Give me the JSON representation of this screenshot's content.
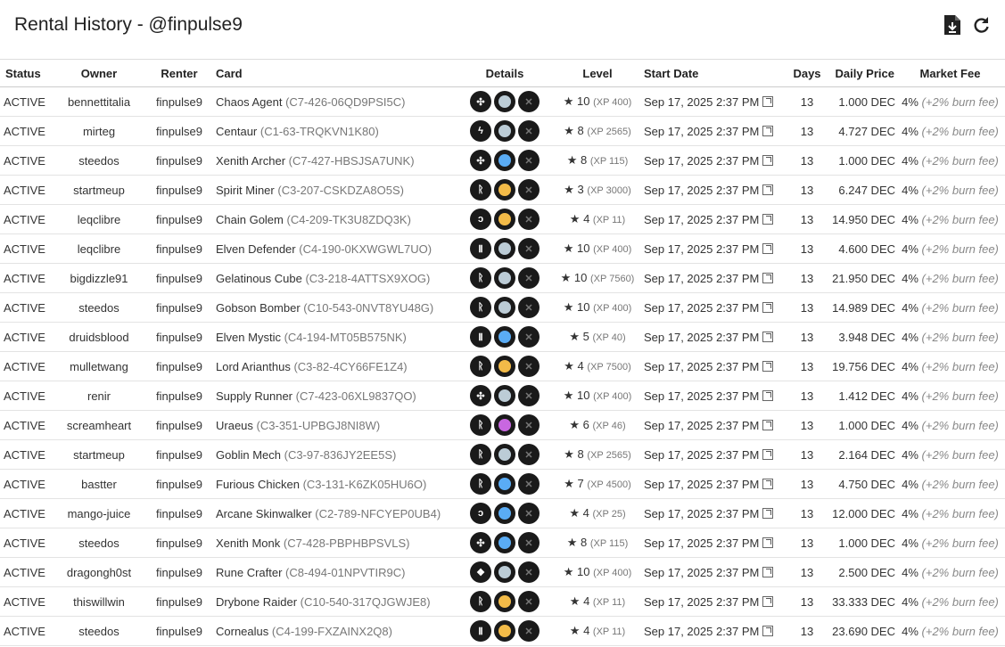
{
  "header": {
    "title": "Rental History - @finpulse9"
  },
  "columns": [
    "Status",
    "Owner",
    "Renter",
    "Card",
    "Details",
    "Level",
    "Start Date",
    "Days",
    "Daily Price",
    "Market Fee"
  ],
  "colors": {
    "grey": "#bcccd6",
    "blue": "#5aacf5",
    "gold": "#f3bb48",
    "purple": "#c867e0"
  },
  "rows": [
    [
      "ACTIVE",
      "bennettitalia",
      "finpulse9",
      "Chaos Agent",
      "(C7-426-06QD9PSI5C)",
      "chaos",
      "grey",
      "10",
      "(XP 400)",
      "Sep 17, 2025 2:37 PM",
      "13",
      "1.000 DEC",
      "4%",
      "(+2% burn fee)"
    ],
    [
      "ACTIVE",
      "mirteg",
      "finpulse9",
      "Centaur",
      "(C1-63-TRQKVN1K80)",
      "alpha",
      "grey",
      "8",
      "(XP 2565)",
      "Sep 17, 2025 2:37 PM",
      "13",
      "4.727 DEC",
      "4%",
      "(+2% burn fee)"
    ],
    [
      "ACTIVE",
      "steedos",
      "finpulse9",
      "Xenith Archer",
      "(C7-427-HBSJSA7UNK)",
      "chaos",
      "blue",
      "8",
      "(XP 115)",
      "Sep 17, 2025 2:37 PM",
      "13",
      "1.000 DEC",
      "4%",
      "(+2% burn fee)"
    ],
    [
      "ACTIVE",
      "startmeup",
      "finpulse9",
      "Spirit Miner",
      "(C3-207-CSKDZA8O5S)",
      "reward",
      "gold",
      "3",
      "(XP 3000)",
      "Sep 17, 2025 2:37 PM",
      "13",
      "6.247 DEC",
      "4%",
      "(+2% burn fee)"
    ],
    [
      "ACTIVE",
      "leqclibre",
      "finpulse9",
      "Chain Golem",
      "(C4-209-TK3U8ZDQ3K)",
      "promo",
      "gold",
      "4",
      "(XP 11)",
      "Sep 17, 2025 2:37 PM",
      "13",
      "14.950 DEC",
      "4%",
      "(+2% burn fee)"
    ],
    [
      "ACTIVE",
      "leqclibre",
      "finpulse9",
      "Elven Defender",
      "(C4-190-0KXWGWL7UO)",
      "untamed",
      "grey",
      "10",
      "(XP 400)",
      "Sep 17, 2025 2:37 PM",
      "13",
      "4.600 DEC",
      "4%",
      "(+2% burn fee)"
    ],
    [
      "ACTIVE",
      "bigdizzle91",
      "finpulse9",
      "Gelatinous Cube",
      "(C3-218-4ATTSX9XOG)",
      "reward",
      "grey",
      "10",
      "(XP 7560)",
      "Sep 17, 2025 2:37 PM",
      "13",
      "21.950 DEC",
      "4%",
      "(+2% burn fee)"
    ],
    [
      "ACTIVE",
      "steedos",
      "finpulse9",
      "Gobson Bomber",
      "(C10-543-0NVT8YU48G)",
      "reward",
      "grey",
      "10",
      "(XP 400)",
      "Sep 17, 2025 2:37 PM",
      "13",
      "14.989 DEC",
      "4%",
      "(+2% burn fee)"
    ],
    [
      "ACTIVE",
      "druidsblood",
      "finpulse9",
      "Elven Mystic",
      "(C4-194-MT05B575NK)",
      "untamed",
      "blue",
      "5",
      "(XP 40)",
      "Sep 17, 2025 2:37 PM",
      "13",
      "3.948 DEC",
      "4%",
      "(+2% burn fee)"
    ],
    [
      "ACTIVE",
      "mulletwang",
      "finpulse9",
      "Lord Arianthus",
      "(C3-82-4CY66FE1Z4)",
      "reward",
      "gold",
      "4",
      "(XP 7500)",
      "Sep 17, 2025 2:37 PM",
      "13",
      "19.756 DEC",
      "4%",
      "(+2% burn fee)"
    ],
    [
      "ACTIVE",
      "renir",
      "finpulse9",
      "Supply Runner",
      "(C7-423-06XL9837QO)",
      "chaos",
      "grey",
      "10",
      "(XP 400)",
      "Sep 17, 2025 2:37 PM",
      "13",
      "1.412 DEC",
      "4%",
      "(+2% burn fee)"
    ],
    [
      "ACTIVE",
      "screamheart",
      "finpulse9",
      "Uraeus",
      "(C3-351-UPBGJ8NI8W)",
      "reward",
      "purple",
      "6",
      "(XP 46)",
      "Sep 17, 2025 2:37 PM",
      "13",
      "1.000 DEC",
      "4%",
      "(+2% burn fee)"
    ],
    [
      "ACTIVE",
      "startmeup",
      "finpulse9",
      "Goblin Mech",
      "(C3-97-836JY2EE5S)",
      "reward",
      "grey",
      "8",
      "(XP 2565)",
      "Sep 17, 2025 2:37 PM",
      "13",
      "2.164 DEC",
      "4%",
      "(+2% burn fee)"
    ],
    [
      "ACTIVE",
      "bastter",
      "finpulse9",
      "Furious Chicken",
      "(C3-131-K6ZK05HU6O)",
      "reward",
      "blue",
      "7",
      "(XP 4500)",
      "Sep 17, 2025 2:37 PM",
      "13",
      "4.750 DEC",
      "4%",
      "(+2% burn fee)"
    ],
    [
      "ACTIVE",
      "mango-juice",
      "finpulse9",
      "Arcane Skinwalker",
      "(C2-789-NFCYEP0UB4)",
      "promo",
      "blue",
      "4",
      "(XP 25)",
      "Sep 17, 2025 2:37 PM",
      "13",
      "12.000 DEC",
      "4%",
      "(+2% burn fee)"
    ],
    [
      "ACTIVE",
      "steedos",
      "finpulse9",
      "Xenith Monk",
      "(C7-428-PBPHBPSVLS)",
      "chaos",
      "blue",
      "8",
      "(XP 115)",
      "Sep 17, 2025 2:37 PM",
      "13",
      "1.000 DEC",
      "4%",
      "(+2% burn fee)"
    ],
    [
      "ACTIVE",
      "dragongh0st",
      "finpulse9",
      "Rune Crafter",
      "(C8-494-01NPVTIR9C)",
      "rebellion",
      "grey",
      "10",
      "(XP 400)",
      "Sep 17, 2025 2:37 PM",
      "13",
      "2.500 DEC",
      "4%",
      "(+2% burn fee)"
    ],
    [
      "ACTIVE",
      "thiswillwin",
      "finpulse9",
      "Drybone Raider",
      "(C10-540-317QJGWJE8)",
      "reward",
      "gold",
      "4",
      "(XP 11)",
      "Sep 17, 2025 2:37 PM",
      "13",
      "33.333 DEC",
      "4%",
      "(+2% burn fee)"
    ],
    [
      "ACTIVE",
      "steedos",
      "finpulse9",
      "Cornealus",
      "(C4-199-FXZAINX2Q8)",
      "untamed",
      "gold",
      "4",
      "(XP 11)",
      "Sep 17, 2025 2:37 PM",
      "13",
      "23.690 DEC",
      "4%",
      "(+2% burn fee)"
    ]
  ]
}
